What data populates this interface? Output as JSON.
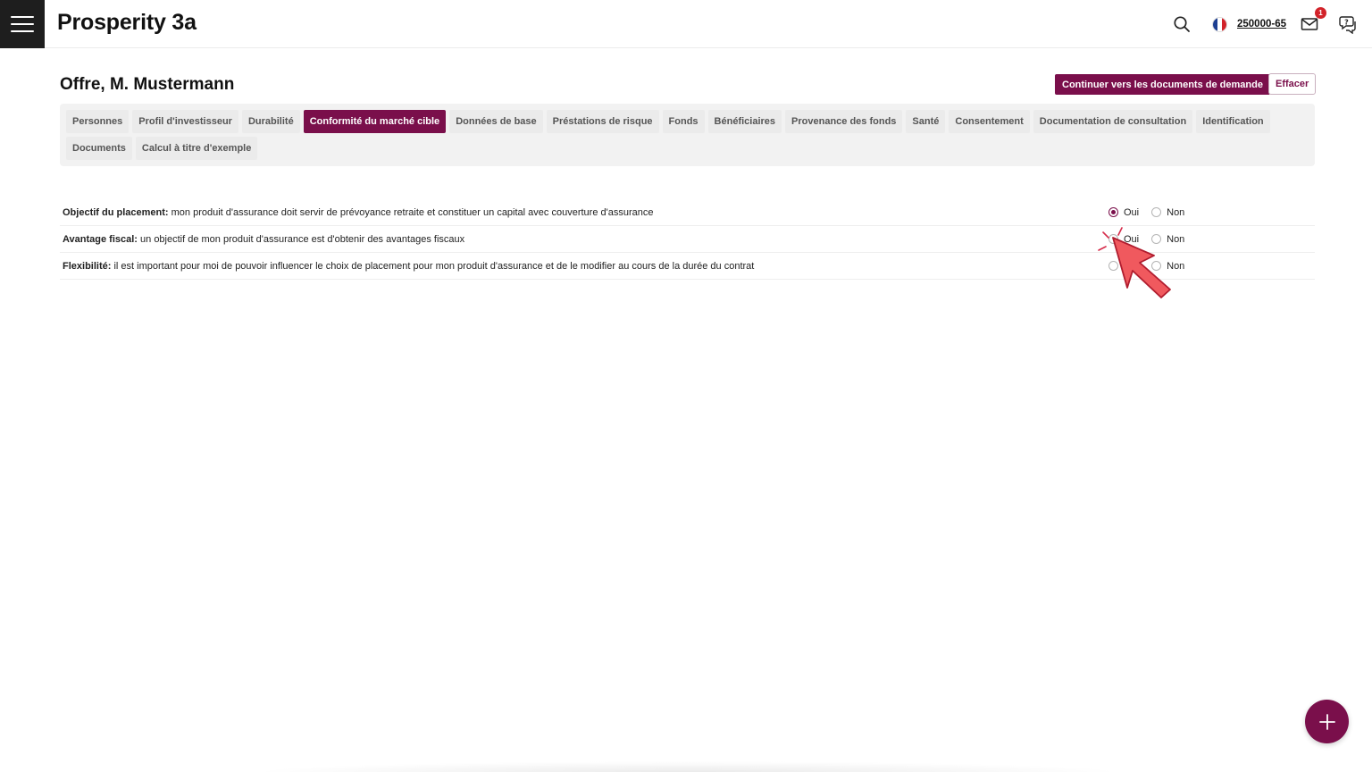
{
  "header": {
    "app_title": "Prosperity 3a",
    "contract_number": "250000-65",
    "mail_badge_count": "1",
    "flag_colors": [
      "#1d3f91",
      "#ffffff",
      "#d2232a"
    ]
  },
  "page": {
    "title": "Offre, M. Mustermann",
    "primary_action_label": "Continuer vers les documents de demande",
    "secondary_action_label": "Effacer"
  },
  "tabs": {
    "row1": [
      {
        "label": "Personnes"
      },
      {
        "label": "Profil d'investisseur"
      },
      {
        "label": "Durabilité"
      },
      {
        "label": "Conformité du marché cible"
      },
      {
        "label": "Données de base"
      },
      {
        "label": "Préstations de risque"
      },
      {
        "label": "Fonds"
      },
      {
        "label": "Bénéficiaires"
      },
      {
        "label": "Provenance des fonds"
      },
      {
        "label": "Santé"
      },
      {
        "label": "Consentement"
      },
      {
        "label": "Documentation de consultation"
      },
      {
        "label": "Identification"
      }
    ],
    "row2": [
      {
        "label": "Documents"
      },
      {
        "label": "Calcul à titre d'exemple"
      }
    ],
    "active": "Conformité du marché cible"
  },
  "questions": [
    {
      "label": "Objectif du placement:",
      "text": " mon produit d'assurance doit servir de prévoyance retraite et constituer un capital avec couverture d'assurance",
      "yes": "Oui",
      "no": "Non",
      "selected": "Oui"
    },
    {
      "label": "Avantage fiscal:",
      "text": " un objectif de mon produit d'assurance est d'obtenir des avantages fiscaux",
      "yes": "Oui",
      "no": "Non",
      "selected": ""
    },
    {
      "label": "Flexibilité:",
      "text": " il est important pour moi de pouvoir influencer le choix de placement pour mon produit d'assurance et de le modifier au cours de la durée du contrat",
      "yes": "Oui",
      "no": "Non",
      "selected": ""
    }
  ],
  "accent_color": "#7a0f4b",
  "icons": {
    "menu": "hamburger-icon",
    "search": "search-icon",
    "flag": "flag-france-icon",
    "mail": "mail-icon",
    "help": "chat-help-icon",
    "add": "plus-icon"
  }
}
